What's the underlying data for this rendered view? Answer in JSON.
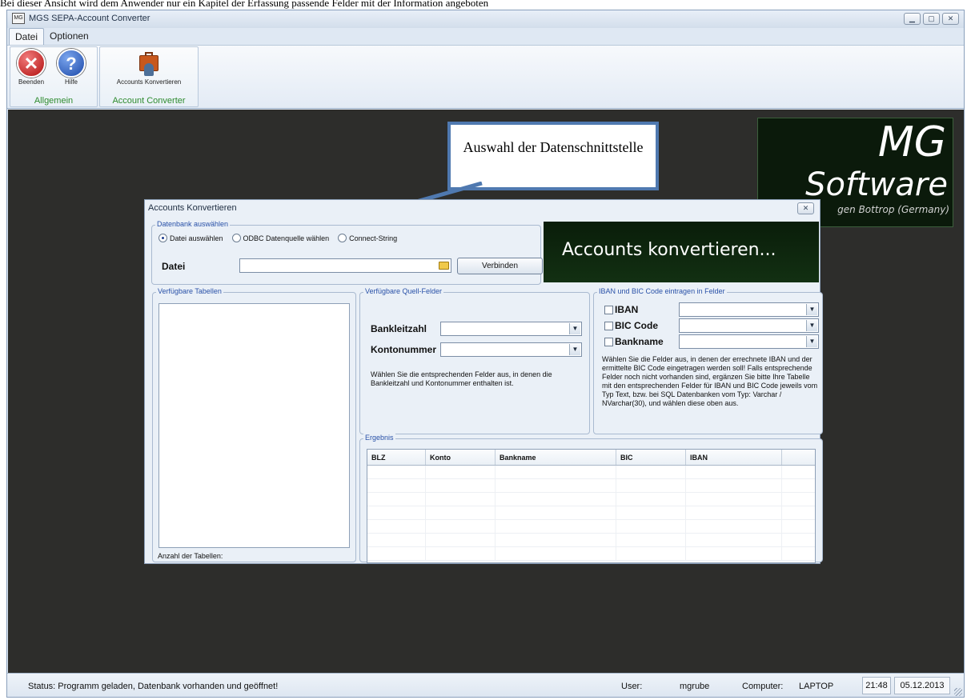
{
  "page_caption": "Bei dieser Ansicht wird dem Anwender nur ein Kapitel der Erfassung passende Felder mit der Information angeboten",
  "window": {
    "title": "MGS SEPA-Account Converter",
    "icon_text": "MG"
  },
  "menu": {
    "tabs": [
      "Datei",
      "Optionen"
    ]
  },
  "ribbon": {
    "groups": [
      {
        "label": "Allgemein",
        "buttons": [
          {
            "label": "Beenden",
            "icon": "close-icon"
          },
          {
            "label": "Hilfe",
            "icon": "help-icon"
          }
        ]
      },
      {
        "label": "Account Converter",
        "buttons": [
          {
            "label": "Accounts Konvertieren",
            "icon": "briefcase-user-icon"
          }
        ]
      }
    ]
  },
  "logo": {
    "line1": "MG",
    "line2": "Software",
    "subline": "gen Bottrop (Germany)"
  },
  "callout": {
    "text": "Auswahl der Datenschnittstelle"
  },
  "dialog": {
    "title": "Accounts Konvertieren",
    "db_group": {
      "title": "Datenbank auswählen",
      "options": [
        "Datei auswählen",
        "ODBC Datenquelle wählen",
        "Connect-String"
      ],
      "selected": "Datei auswählen",
      "file_label": "Datei",
      "file_value": "",
      "connect_button": "Verbinden"
    },
    "banner": "Accounts konvertieren...",
    "tables_group": {
      "title": "Verfügbare Tabellen",
      "count_label": "Anzahl der Tabellen:"
    },
    "source_group": {
      "title": "Verfügbare Quell-Felder",
      "bank_code_label": "Bankleitzahl",
      "account_label": "Kontonummer",
      "hint": "Wählen Sie die entsprechenden Felder aus, in denen die Bankleitzahl und Kontonummer enthalten ist."
    },
    "target_group": {
      "title": "IBAN und BIC Code eintragen in Felder",
      "fields": [
        "IBAN",
        "BIC Code",
        "Bankname"
      ],
      "hint": "Wählen Sie die Felder aus, in denen der errechnete IBAN und der ermittelte BIC Code eingetragen werden soll! Falls entsprechende Felder noch nicht vorhanden sind, ergänzen Sie bitte Ihre Tabelle mit den entsprechenden Felder für IBAN und BIC Code jeweils vom Typ Text, bzw. bei SQL Datenbanken vom Typ: Varchar / NVarchar(30), und wählen diese oben aus."
    },
    "result_group": {
      "title": "Ergebnis",
      "columns": [
        "BLZ",
        "Konto",
        "Bankname",
        "BIC",
        "IBAN",
        ""
      ]
    }
  },
  "status": {
    "text": "Status: Programm geladen, Datenbank vorhanden und geöffnet!",
    "user_label": "User:",
    "user": "mgrube",
    "computer_label": "Computer:",
    "computer": "LAPTOP",
    "time": "21:48",
    "date": "05.12.2013"
  }
}
